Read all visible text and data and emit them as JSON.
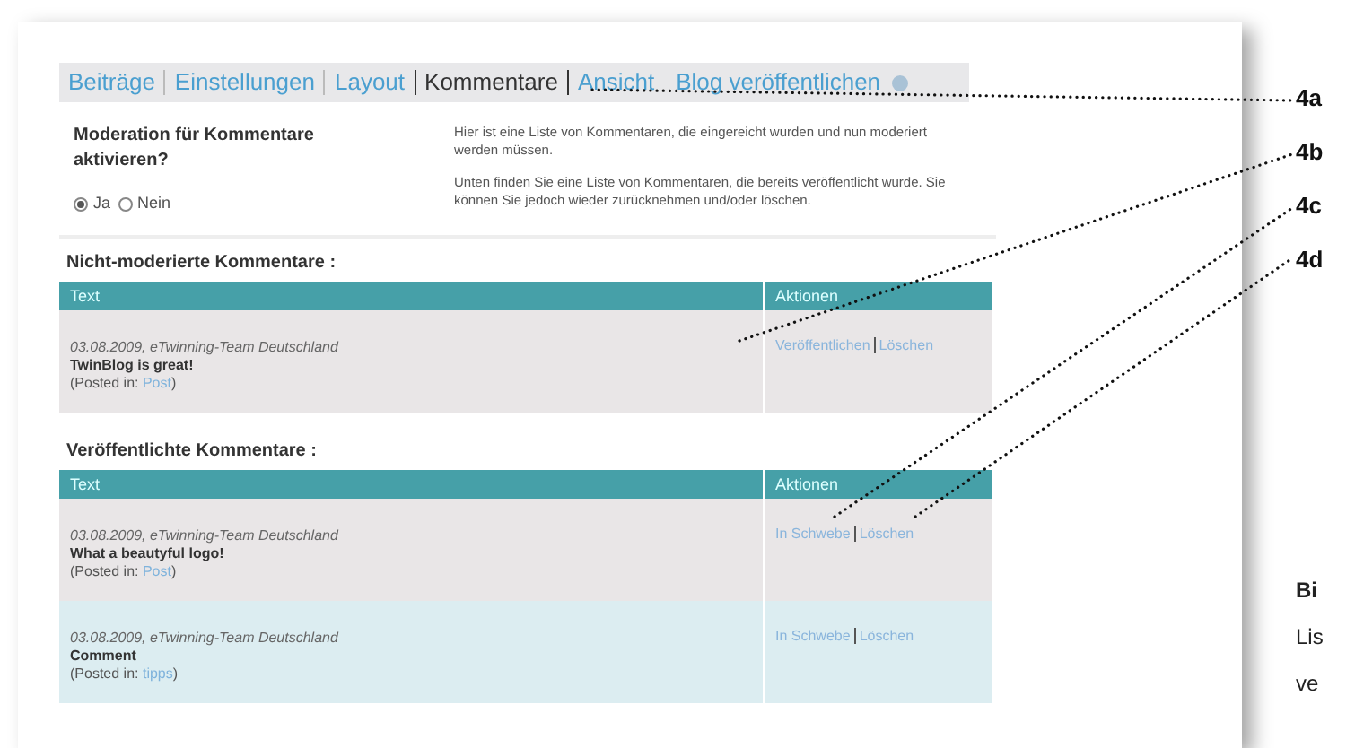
{
  "nav": {
    "tabs": [
      {
        "label": "Beiträge",
        "kind": "tab",
        "selected": false
      },
      {
        "label": "Einstellungen",
        "kind": "tab",
        "selected": false
      },
      {
        "label": "Layout",
        "kind": "tab",
        "selected": false
      },
      {
        "label": "Kommentare",
        "kind": "tab",
        "selected": true
      },
      {
        "label": "Ansicht",
        "kind": "tab",
        "selected": false
      },
      {
        "label": "Blog veröffentlichen",
        "kind": "publish",
        "selected": false
      }
    ]
  },
  "moderation": {
    "question": "Moderation für Kommentare aktivieren?",
    "options": [
      {
        "label": "Ja",
        "selected": true
      },
      {
        "label": "Nein",
        "selected": false
      }
    ],
    "info": [
      "Hier ist eine Liste von Kommentaren, die eingereicht wurden und nun moderiert werden müssen.",
      "Unten finden Sie eine Liste von Kommentaren, die bereits veröffentlicht wurde. Sie können Sie jedoch wieder zurücknehmen und/oder löschen."
    ]
  },
  "sections": [
    {
      "title": "Nicht-moderierte Kommentare :",
      "columns": [
        "Text",
        "Aktionen"
      ],
      "rows": [
        {
          "meta": "03.08.2009, eTwinning-Team Deutschland",
          "title": "TwinBlog is great!",
          "posted": "(Posted in: ",
          "post": "Post",
          "posted_end": ")",
          "actions": [
            "Veröffentlichen",
            "Löschen"
          ],
          "highlighted": false
        }
      ]
    },
    {
      "title": "Veröffentlichte Kommentare :",
      "columns": [
        "Text",
        "Aktionen"
      ],
      "rows": [
        {
          "meta": "03.08.2009, eTwinning-Team Deutschland",
          "title": "What a beautyful logo!",
          "posted": "(Posted in: ",
          "post": "Post",
          "posted_end": ")",
          "actions": [
            "In Schwebe",
            "Löschen"
          ],
          "highlighted": false
        },
        {
          "meta": "03.08.2009, eTwinning-Team Deutschland",
          "title": "Comment",
          "posted": "(Posted in: ",
          "post": "tipps",
          "posted_end": ")",
          "actions": [
            "In Schwebe",
            "Löschen"
          ],
          "highlighted": true
        }
      ]
    }
  ],
  "callouts": [
    "4a",
    "4b",
    "4c",
    "4d"
  ],
  "caption": [
    "Bi",
    "Lis",
    "ve"
  ]
}
